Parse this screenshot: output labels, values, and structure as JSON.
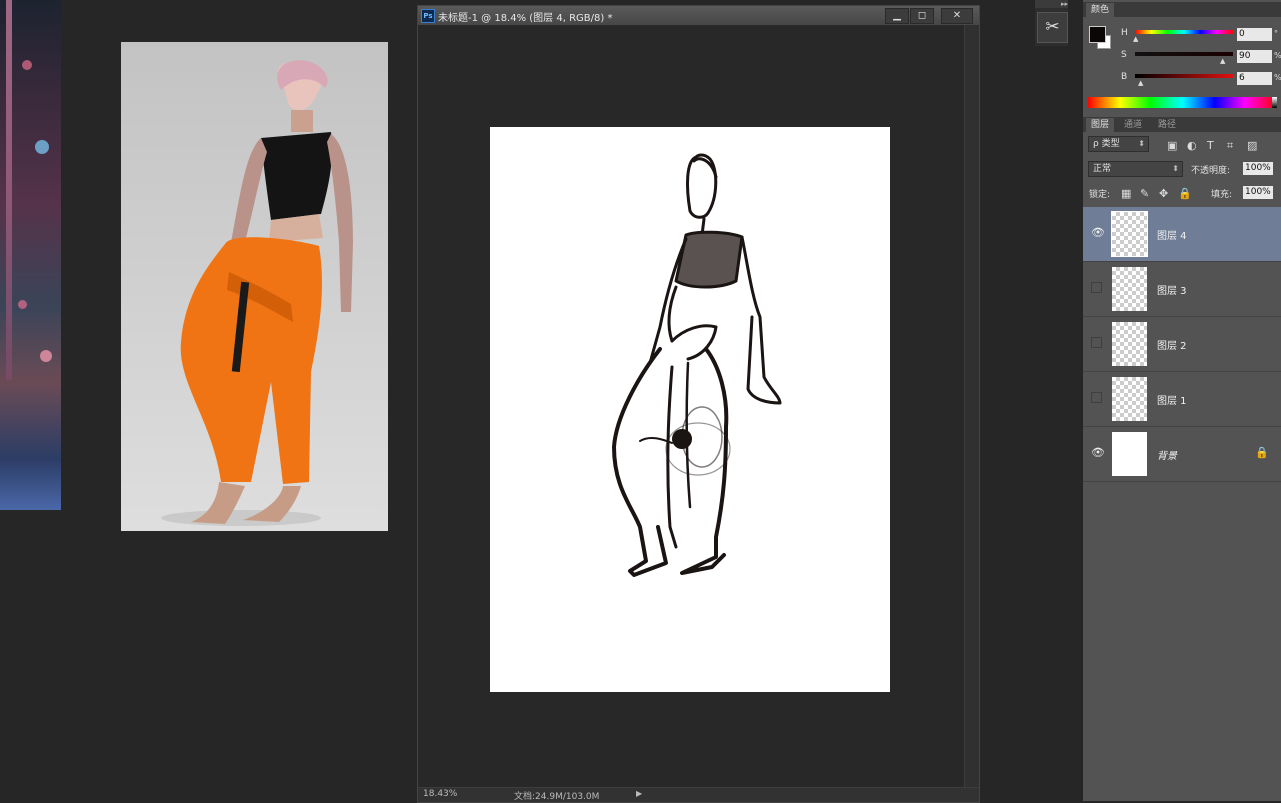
{
  "document": {
    "title": "未标题-1 @ 18.4% (图层 4, RGB/8) *",
    "zoom": "18.43%",
    "doc_size": "文档:24.9M/103.0M",
    "window_buttons": [
      "▁",
      "◻",
      "✕"
    ]
  },
  "color_panel": {
    "tab": "颜色",
    "foreground": "#0b0706",
    "background": "#ffffff",
    "sliders": [
      {
        "label": "H",
        "value": "0",
        "unit": "°"
      },
      {
        "label": "S",
        "value": "90",
        "unit": "%"
      },
      {
        "label": "B",
        "value": "6",
        "unit": "%"
      }
    ]
  },
  "layers_panel": {
    "tabs": [
      "图层",
      "通道",
      "路径"
    ],
    "filter_kind": "ρ 类型",
    "blend_mode": "正常",
    "opacity_label": "不透明度:",
    "opacity_value": "100%",
    "lock_label": "锁定:",
    "fill_label": "填充:",
    "fill_value": "100%",
    "layers": [
      {
        "name": "图层 4",
        "visible": true,
        "selected": true
      },
      {
        "name": "图层 3",
        "visible": false,
        "selected": false
      },
      {
        "name": "图层 2",
        "visible": false,
        "selected": false
      },
      {
        "name": "图层 1",
        "visible": false,
        "selected": false
      },
      {
        "name": "背景",
        "visible": true,
        "selected": false,
        "locked": true
      }
    ]
  },
  "icons": {
    "tool": "✂",
    "eye": "👁",
    "lock": "🔒",
    "filter_icons": [
      "▣",
      "◐",
      "T",
      "⌗",
      "▨"
    ],
    "lock_icons": [
      "▦",
      "✎",
      "✥",
      "🔒"
    ]
  }
}
